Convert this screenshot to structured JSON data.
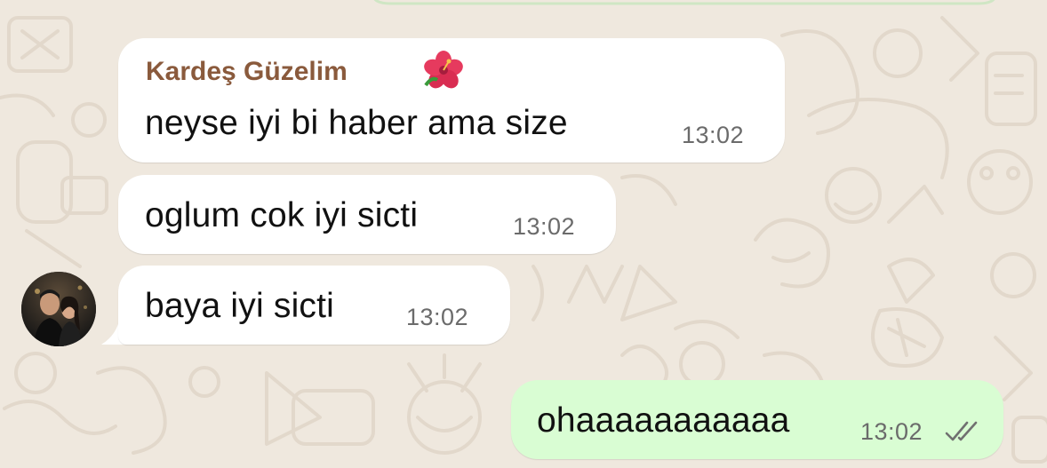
{
  "chat": {
    "messages": [
      {
        "direction": "incoming",
        "sender": "Kardeş Güzelim",
        "sender_emoji": "hibiscus",
        "text": "neyse iyi bi haber ama size",
        "time": "13:02"
      },
      {
        "direction": "incoming",
        "text": "oglum cok iyi sicti",
        "time": "13:02"
      },
      {
        "direction": "incoming",
        "text": "baya iyi sicti",
        "time": "13:02",
        "has_avatar": true
      },
      {
        "direction": "outgoing",
        "text": "ohaaaaaaaaaaa",
        "time": "13:02",
        "status": "read-double-check"
      }
    ]
  },
  "colors": {
    "wallpaper": "#efe8de",
    "incoming_bubble": "#ffffff",
    "outgoing_bubble": "#d9fdd3",
    "sender_name": "#8a5a3c",
    "time_text": "#6b6b6b",
    "read_ticks": "#707070"
  },
  "icons": {
    "sender_emoji": "hibiscus-icon",
    "status": "double-check-icon"
  }
}
